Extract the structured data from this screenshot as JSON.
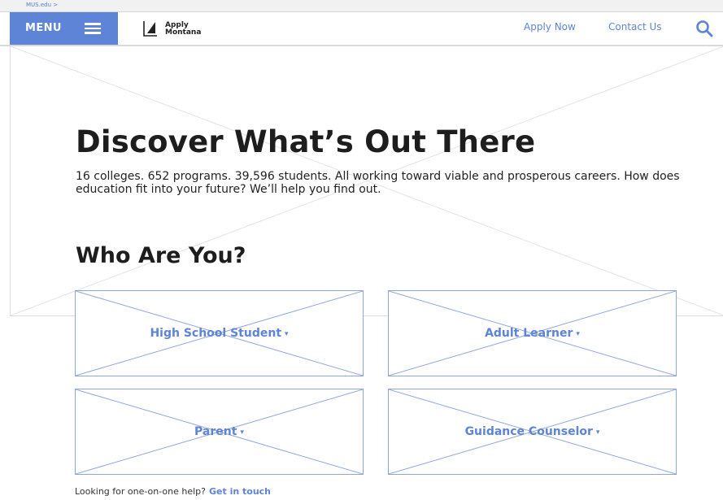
{
  "topbar": {
    "breadcrumb": "MUS.edu >"
  },
  "header": {
    "menu_label": "MENU",
    "logo_line1": "Apply",
    "logo_line2": "Montana",
    "nav": [
      {
        "label": "Apply Now"
      },
      {
        "label": "Contact Us"
      }
    ],
    "search_icon": "search-icon"
  },
  "hero": {
    "title": "Discover What’s Out There",
    "intro": "16 colleges. 652 programs. 39,596 students. All working toward viable and prosperous careers. How does education fit into your future? We’ll help you find out.",
    "who_heading": "Who Are You?"
  },
  "audiences": [
    {
      "label": "High School Student",
      "caret": "▾"
    },
    {
      "label": "Adult Learner",
      "caret": "▾"
    },
    {
      "label": "Parent",
      "caret": "▾"
    },
    {
      "label": "Guidance Counselor",
      "caret": "▾"
    }
  ],
  "help": {
    "text": "Looking for one-on-one help?",
    "link": "Get in touch"
  },
  "colors": {
    "accent": "#5d84d6",
    "card_border": "#8ea6dc",
    "text": "#1d1d1d"
  }
}
